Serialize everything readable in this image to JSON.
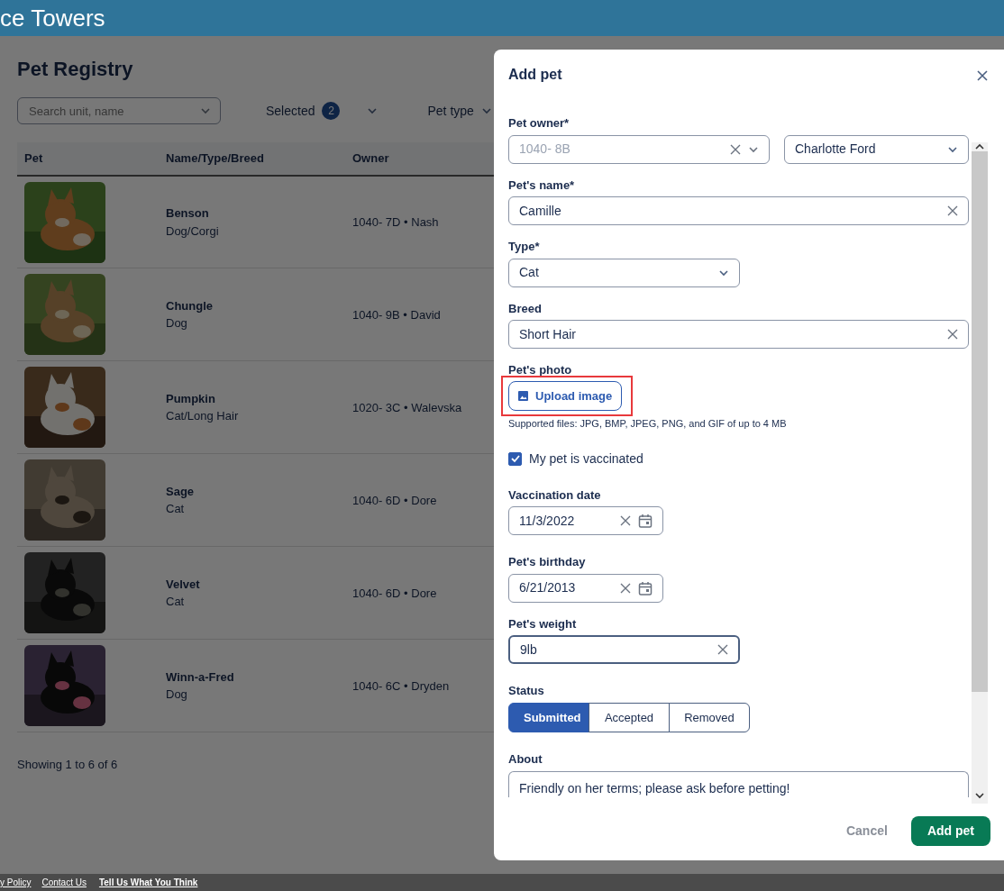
{
  "header": {
    "title": "ce Towers"
  },
  "page": {
    "title": "Pet Registry",
    "search": {
      "placeholder": "Search unit, name"
    },
    "filters": [
      {
        "label": "Selected",
        "count": "2"
      },
      {
        "label": "Pet type"
      }
    ],
    "table": {
      "columns": [
        "Pet",
        "Name/Type/Breed",
        "Owner"
      ],
      "rows": [
        {
          "name": "Benson",
          "type": "Dog/Corgi",
          "owner": "1040- 7D • Nash"
        },
        {
          "name": "Chungle",
          "type": "Dog",
          "owner": "1040- 9B • David"
        },
        {
          "name": "Pumpkin",
          "type": "Cat/Long Hair",
          "owner": "1020- 3C • Walevska"
        },
        {
          "name": "Sage",
          "type": "Cat",
          "owner": "1040- 6D • Dore"
        },
        {
          "name": "Velvet",
          "type": "Cat",
          "owner": "1040- 6D • Dore"
        },
        {
          "name": "Winn-a-Fred",
          "type": "Dog",
          "owner": "1040- 6C • Dryden"
        }
      ]
    },
    "summary": "Showing 1 to 6 of 6"
  },
  "footer": {
    "links": [
      {
        "label": "y Policy",
        "emphasized": false
      },
      {
        "label": "Contact Us",
        "emphasized": false
      },
      {
        "label": "Tell Us What You Think",
        "emphasized": true
      }
    ]
  },
  "modal": {
    "title": "Add pet",
    "fields": [
      {
        "kind": "owner",
        "label": "Pet owner*",
        "unit": {
          "value": "1040- 8B",
          "muted": true
        },
        "resident": {
          "value": "Charlotte Ford"
        }
      },
      {
        "kind": "text",
        "label": "Pet's name*",
        "value": "Camille",
        "wide": true,
        "focused": false
      },
      {
        "kind": "select",
        "label": "Type*",
        "value": "Cat"
      },
      {
        "kind": "text",
        "label": "Breed",
        "value": "Short Hair",
        "wide": true,
        "focused": false
      },
      {
        "kind": "upload",
        "label": "Pet's photo",
        "button": "Upload image",
        "help": "Supported files: JPG, BMP, JPEG, PNG, and GIF of up to 4 MB",
        "highlighted": true
      },
      {
        "kind": "checkbox",
        "label": "My pet is vaccinated",
        "checked": true
      },
      {
        "kind": "date",
        "label": "Vaccination date",
        "value": "11/3/2022"
      },
      {
        "kind": "date",
        "label": "Pet's birthday",
        "value": "6/21/2013"
      },
      {
        "kind": "text",
        "label": "Pet's weight",
        "value": "9lb",
        "wide": false,
        "focused": true
      },
      {
        "kind": "segmented",
        "label": "Status",
        "options": [
          {
            "label": "Submitted",
            "selected": true
          },
          {
            "label": "Accepted",
            "selected": false
          },
          {
            "label": "Removed",
            "selected": false
          }
        ]
      },
      {
        "kind": "textarea",
        "label": "About",
        "value": "Friendly on her terms; please ask before petting!"
      }
    ],
    "buttons": [
      {
        "label": "Cancel",
        "kind": "secondary"
      },
      {
        "label": "Add pet",
        "kind": "primary"
      }
    ]
  }
}
